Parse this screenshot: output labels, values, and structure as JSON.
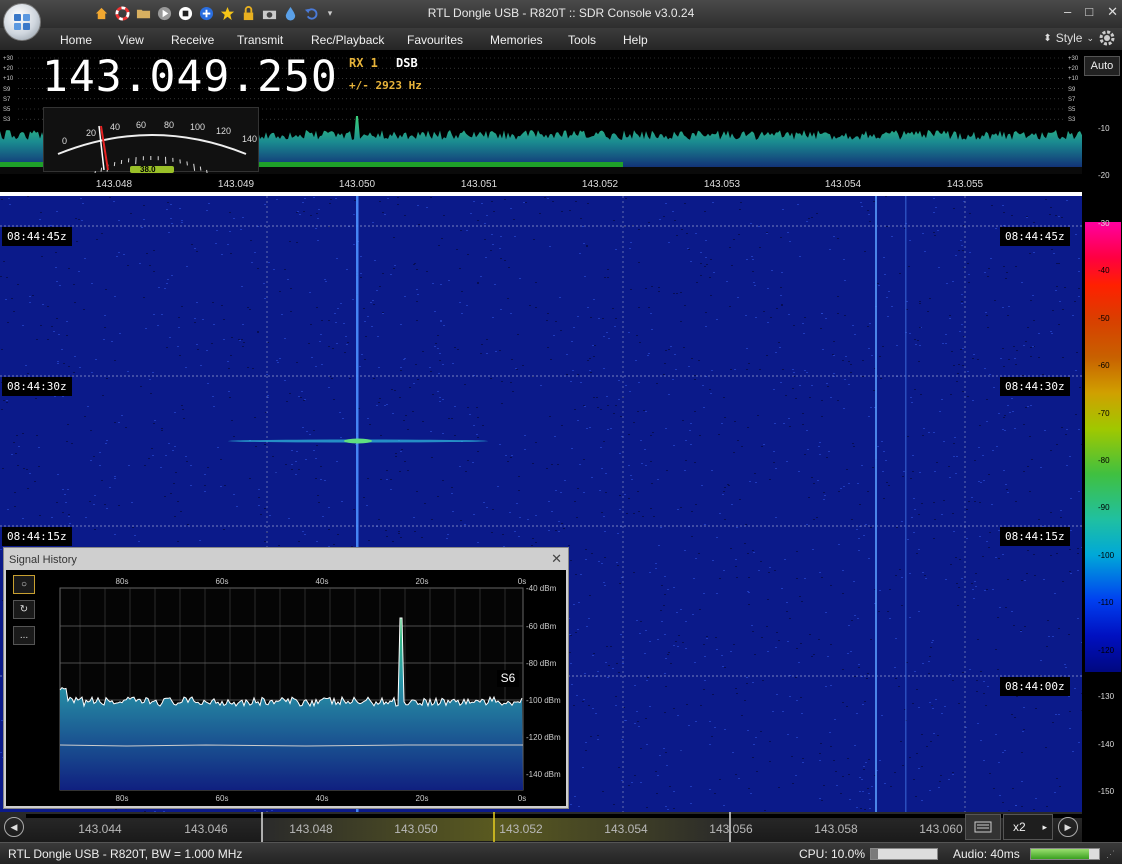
{
  "window": {
    "title": "RTL Dongle USB - R820T :: SDR Console v3.0.24",
    "minimize": "–",
    "maximize": "□",
    "close": "✕"
  },
  "menu": {
    "home": "Home",
    "view": "View",
    "receive": "Receive",
    "transmit": "Transmit",
    "rec_playback": "Rec/Playback",
    "favourites": "Favourites",
    "memories": "Memories",
    "tools": "Tools",
    "help": "Help"
  },
  "style_menu": "Style",
  "quick_access_icons": [
    "home-icon",
    "lifebuoy-icon",
    "folder-icon",
    "play-icon",
    "stop-icon",
    "plus-icon",
    "star-icon",
    "lock-icon",
    "camera-icon",
    "drop-icon",
    "undo-icon",
    "dropdown-icon"
  ],
  "radio": {
    "frequency": "143.049.250",
    "rx": "RX 1",
    "mode": "DSB",
    "offset": "+/- 2923 Hz"
  },
  "smeter": {
    "scale": [
      "0",
      "20",
      "40",
      "60",
      "80",
      "100",
      "120",
      "140"
    ],
    "readout": "38.0"
  },
  "spectrum": {
    "left_scale": [
      "+30",
      "+20",
      "+10",
      "S9",
      "S7",
      "S5",
      "S3"
    ],
    "right_scale": [
      "+30",
      "+20",
      "+10",
      "S9",
      "S7",
      "S5",
      "S3"
    ],
    "freq_axis": [
      "143.048",
      "143.049",
      "143.050",
      "143.051",
      "143.052",
      "143.053",
      "143.054",
      "143.055"
    ]
  },
  "waterfall": {
    "timestamps_left": [
      "08:44:45z",
      "08:44:30z",
      "08:44:15z"
    ],
    "timestamps_right": [
      "08:44:45z",
      "08:44:30z",
      "08:44:15z",
      "08:44:00z"
    ]
  },
  "right_panel": {
    "auto": "Auto",
    "db_scale": [
      "-10",
      "-20",
      "-30",
      "-40",
      "-50",
      "-60",
      "-70",
      "-80",
      "-90",
      "-100",
      "-110",
      "-120",
      "-130",
      "-140",
      "-150"
    ]
  },
  "signal_history": {
    "title": "Signal History",
    "close": "✕",
    "buttons": [
      "○",
      "↻",
      "..."
    ],
    "time_labels": [
      "80s",
      "60s",
      "40s",
      "20s",
      "0s"
    ],
    "dbm_labels": [
      "-40 dBm",
      "-60 dBm",
      "-80 dBm",
      "-100 dBm",
      "-120 dBm",
      "-140 dBm"
    ],
    "s_meter": "S6"
  },
  "bottom_band": {
    "freqs": [
      "143.044",
      "143.046",
      "143.048",
      "143.050",
      "143.052",
      "143.054",
      "143.056",
      "143.058",
      "143.060"
    ],
    "zoom": "x2",
    "left_arrow": "◀",
    "right_arrow": "▶",
    "small_arrow": "▸"
  },
  "status": {
    "text": "RTL Dongle USB - R820T, BW = 1.000 MHz",
    "cpu": "CPU: 10.0%",
    "cpu_level": 0.1,
    "audio": "Audio: 40ms",
    "audio_level": 0.85
  },
  "colors": {
    "spectrum_green": "#22aa66",
    "waterfall_blue": "#0b1a8a",
    "accent_amber": "#e8b43a"
  }
}
